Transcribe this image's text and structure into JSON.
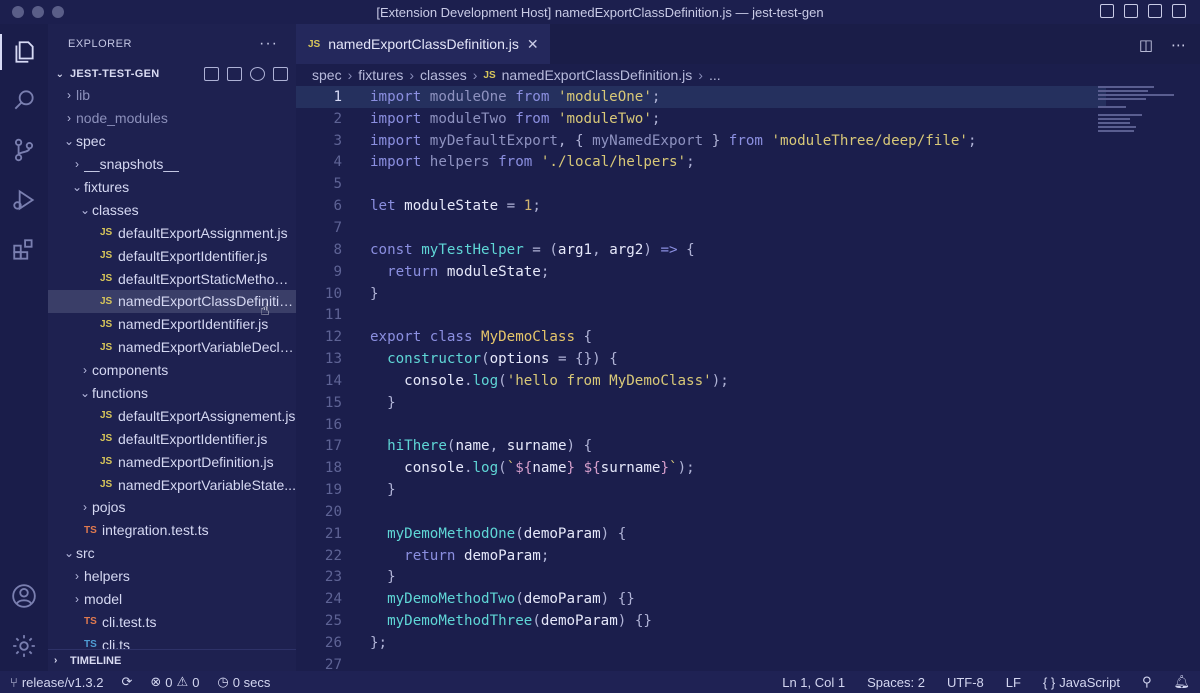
{
  "window": {
    "title": "[Extension Development Host] namedExportClassDefinition.js — jest-test-gen"
  },
  "activity": {
    "items": [
      "explorer-icon",
      "search-icon",
      "source-control-icon",
      "run-debug-icon",
      "extensions-icon",
      "account-icon",
      "settings-gear-icon"
    ]
  },
  "sidebar": {
    "header": "EXPLORER",
    "more": "···",
    "project": "JEST-TEST-GEN",
    "timeline": "TIMELINE",
    "tree": [
      {
        "indent": 1,
        "twisty": "›",
        "icon": "",
        "label": "lib",
        "dim": true
      },
      {
        "indent": 1,
        "twisty": "›",
        "icon": "",
        "label": "node_modules",
        "dim": true
      },
      {
        "indent": 1,
        "twisty": "⌄",
        "icon": "",
        "label": "spec"
      },
      {
        "indent": 2,
        "twisty": "›",
        "icon": "",
        "label": "__snapshots__"
      },
      {
        "indent": 2,
        "twisty": "⌄",
        "icon": "",
        "label": "fixtures"
      },
      {
        "indent": 3,
        "twisty": "⌄",
        "icon": "",
        "label": "classes"
      },
      {
        "indent": 4,
        "twisty": "",
        "icon": "JS",
        "label": "defaultExportAssignment.js"
      },
      {
        "indent": 4,
        "twisty": "",
        "icon": "JS",
        "label": "defaultExportIdentifier.js"
      },
      {
        "indent": 4,
        "twisty": "",
        "icon": "JS",
        "label": "defaultExportStaticMethod.js"
      },
      {
        "indent": 4,
        "twisty": "",
        "icon": "JS",
        "label": "namedExportClassDefinitio...",
        "selected": true
      },
      {
        "indent": 4,
        "twisty": "",
        "icon": "JS",
        "label": "namedExportIdentifier.js"
      },
      {
        "indent": 4,
        "twisty": "",
        "icon": "JS",
        "label": "namedExportVariableDecla..."
      },
      {
        "indent": 3,
        "twisty": "›",
        "icon": "",
        "label": "components"
      },
      {
        "indent": 3,
        "twisty": "⌄",
        "icon": "",
        "label": "functions"
      },
      {
        "indent": 4,
        "twisty": "",
        "icon": "JS",
        "label": "defaultExportAssignement.js"
      },
      {
        "indent": 4,
        "twisty": "",
        "icon": "JS",
        "label": "defaultExportIdentifier.js"
      },
      {
        "indent": 4,
        "twisty": "",
        "icon": "JS",
        "label": "namedExportDefinition.js"
      },
      {
        "indent": 4,
        "twisty": "",
        "icon": "JS",
        "label": "namedExportVariableState..."
      },
      {
        "indent": 3,
        "twisty": "›",
        "icon": "",
        "label": "pojos"
      },
      {
        "indent": 2,
        "twisty": "",
        "icon": "TS",
        "label": "integration.test.ts",
        "tsred": true
      },
      {
        "indent": 1,
        "twisty": "⌄",
        "icon": "",
        "label": "src"
      },
      {
        "indent": 2,
        "twisty": "›",
        "icon": "",
        "label": "helpers"
      },
      {
        "indent": 2,
        "twisty": "›",
        "icon": "",
        "label": "model"
      },
      {
        "indent": 2,
        "twisty": "",
        "icon": "TS",
        "label": "cli.test.ts",
        "tsred": true
      },
      {
        "indent": 2,
        "twisty": "",
        "icon": "TS",
        "label": "cli.ts"
      }
    ]
  },
  "editor": {
    "tab": {
      "icon": "JS",
      "label": "namedExportClassDefinition.js",
      "close": "✕"
    },
    "breadcrumb": [
      "spec",
      "fixtures",
      "classes"
    ],
    "breadcrumb_file": "namedExportClassDefinition.js",
    "breadcrumb_more": "...",
    "current_line": 1,
    "lines": [
      [
        [
          "kw",
          "import "
        ],
        [
          "dim",
          "moduleOne "
        ],
        [
          "kw",
          "from "
        ],
        [
          "str",
          "'moduleOne'"
        ],
        [
          "pn",
          ";"
        ]
      ],
      [
        [
          "kw",
          "import "
        ],
        [
          "dim",
          "moduleTwo "
        ],
        [
          "kw",
          "from "
        ],
        [
          "str",
          "'moduleTwo'"
        ],
        [
          "pn",
          ";"
        ]
      ],
      [
        [
          "kw",
          "import "
        ],
        [
          "dim",
          "myDefaultExport"
        ],
        [
          "pn",
          ", { "
        ],
        [
          "dim",
          "myNamedExport "
        ],
        [
          "pn",
          "} "
        ],
        [
          "kw",
          "from "
        ],
        [
          "str",
          "'moduleThree/deep/file'"
        ],
        [
          "pn",
          ";"
        ]
      ],
      [
        [
          "kw",
          "import "
        ],
        [
          "dim",
          "helpers "
        ],
        [
          "kw",
          "from "
        ],
        [
          "str",
          "'./local/helpers'"
        ],
        [
          "pn",
          ";"
        ]
      ],
      [],
      [
        [
          "kw",
          "let "
        ],
        [
          "var",
          "moduleState "
        ],
        [
          "pn",
          "= "
        ],
        [
          "num",
          "1"
        ],
        [
          "pn",
          ";"
        ]
      ],
      [],
      [
        [
          "kw",
          "const "
        ],
        [
          "fn",
          "myTestHelper "
        ],
        [
          "pn",
          "= ("
        ],
        [
          "var",
          "arg1"
        ],
        [
          "pn",
          ", "
        ],
        [
          "var",
          "arg2"
        ],
        [
          "pn",
          ") "
        ],
        [
          "kw",
          "=> "
        ],
        [
          "pn",
          "{"
        ]
      ],
      [
        [
          "pn",
          "  "
        ],
        [
          "kw",
          "return "
        ],
        [
          "var",
          "moduleState"
        ],
        [
          "pn",
          ";"
        ]
      ],
      [
        [
          "pn",
          "}"
        ]
      ],
      [],
      [
        [
          "kw",
          "export "
        ],
        [
          "kw",
          "class "
        ],
        [
          "cls",
          "MyDemoClass "
        ],
        [
          "pn",
          "{"
        ]
      ],
      [
        [
          "pn",
          "  "
        ],
        [
          "fn",
          "constructor"
        ],
        [
          "pn",
          "("
        ],
        [
          "var",
          "options "
        ],
        [
          "pn",
          "= {}) {"
        ]
      ],
      [
        [
          "pn",
          "    "
        ],
        [
          "var",
          "console"
        ],
        [
          "pn",
          "."
        ],
        [
          "fn",
          "log"
        ],
        [
          "pn",
          "("
        ],
        [
          "str",
          "'hello from MyDemoClass'"
        ],
        [
          "pn",
          ");"
        ]
      ],
      [
        [
          "pn",
          "  }"
        ]
      ],
      [],
      [
        [
          "pn",
          "  "
        ],
        [
          "fn",
          "hiThere"
        ],
        [
          "pn",
          "("
        ],
        [
          "var",
          "name"
        ],
        [
          "pn",
          ", "
        ],
        [
          "var",
          "surname"
        ],
        [
          "pn",
          ") {"
        ]
      ],
      [
        [
          "pn",
          "    "
        ],
        [
          "var",
          "console"
        ],
        [
          "pn",
          "."
        ],
        [
          "fn",
          "log"
        ],
        [
          "pn",
          "("
        ],
        [
          "str",
          "`"
        ],
        [
          "tpl",
          "${"
        ],
        [
          "var",
          "name"
        ],
        [
          "tpl",
          "} ${"
        ],
        [
          "var",
          "surname"
        ],
        [
          "tpl",
          "}"
        ],
        [
          "str",
          "`"
        ],
        [
          "pn",
          ");"
        ]
      ],
      [
        [
          "pn",
          "  }"
        ]
      ],
      [],
      [
        [
          "pn",
          "  "
        ],
        [
          "fn",
          "myDemoMethodOne"
        ],
        [
          "pn",
          "("
        ],
        [
          "var",
          "demoParam"
        ],
        [
          "pn",
          ") {"
        ]
      ],
      [
        [
          "pn",
          "    "
        ],
        [
          "kw",
          "return "
        ],
        [
          "var",
          "demoParam"
        ],
        [
          "pn",
          ";"
        ]
      ],
      [
        [
          "pn",
          "  }"
        ]
      ],
      [
        [
          "pn",
          "  "
        ],
        [
          "fn",
          "myDemoMethodTwo"
        ],
        [
          "pn",
          "("
        ],
        [
          "var",
          "demoParam"
        ],
        [
          "pn",
          ") {}"
        ]
      ],
      [
        [
          "pn",
          "  "
        ],
        [
          "fn",
          "myDemoMethodThree"
        ],
        [
          "pn",
          "("
        ],
        [
          "var",
          "demoParam"
        ],
        [
          "pn",
          ") {}"
        ]
      ],
      [
        [
          "pn",
          "};"
        ]
      ],
      []
    ]
  },
  "statusbar": {
    "branch": "release/v1.3.2",
    "errors": "0",
    "warnings": "0",
    "timer": "0 secs",
    "position": "Ln 1, Col 1",
    "spaces": "Spaces: 2",
    "encoding": "UTF-8",
    "eol": "LF",
    "language": "JavaScript",
    "language_icon": "{ }"
  },
  "colors": {
    "background": "#1b1e4c",
    "accent_keyword": "#8b8fe0",
    "accent_string": "#d8c878",
    "accent_function": "#5fd6d6"
  }
}
